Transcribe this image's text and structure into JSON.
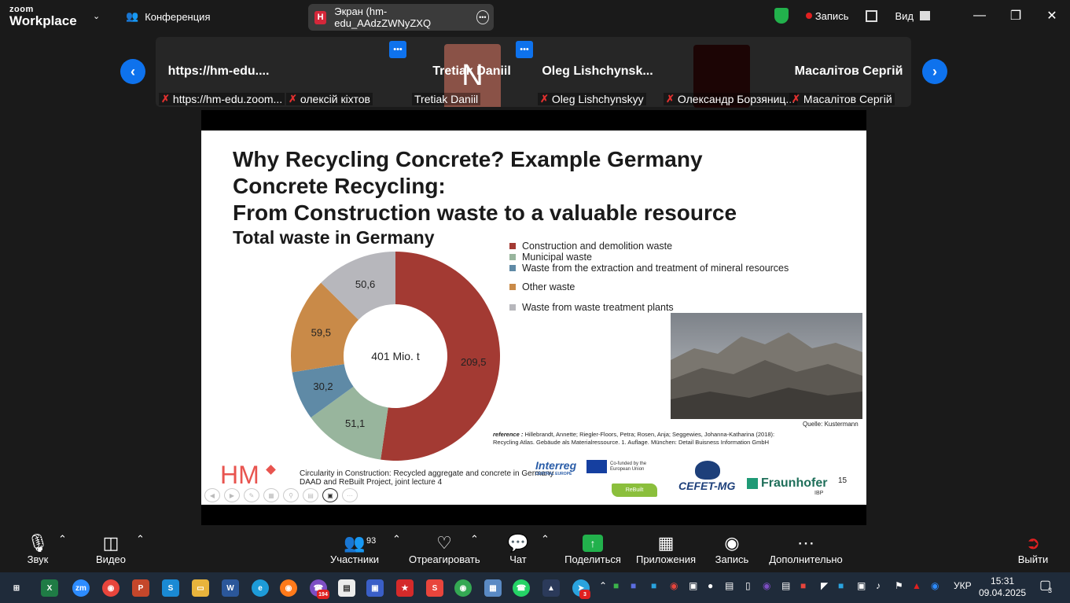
{
  "app": {
    "logo_top": "zoom",
    "logo_bottom": "Workplace"
  },
  "topbar": {
    "conference_label": "Конференция",
    "screen_tab_letter": "H",
    "screen_tab_label": "Экран (hm-edu_AAdzZWNyZXQ",
    "record_label": "Запись",
    "view_label": "Вид"
  },
  "participants_strip": [
    {
      "big": "https://hm-edu....",
      "caption": "https://hm-edu.zoom..."
    },
    {
      "avatar_letter": "N",
      "caption": "олексій кіхтов"
    },
    {
      "big": "Tretiak Daniil",
      "caption": "Tretiak Daniil"
    },
    {
      "big": "Oleg  Lishchynsk...",
      "caption": "Oleg Lishchynskyy"
    },
    {
      "caption": "Олександр Борзяниц..."
    },
    {
      "big": "Масалітов Сергій",
      "caption": "Масалітов Сергій"
    }
  ],
  "slide": {
    "title_lines": [
      "Why Recycling Concrete? Example Germany",
      "Concrete Recycling:",
      "From Construction waste to a valuable resource"
    ],
    "subtitle": "Total waste in Germany",
    "photo_source": "Quelle: Kustermann",
    "reference_label": "reference :",
    "reference_text": "Hillebrandt, Annette; Riegler-Floors, Petra; Rosen, Anja; Seggewies, Johanna-Katharina (2018): Recycling Atlas. Gebäude als Materialressource. 1. Auflage. München: Detail Buisness Information GmbH",
    "footer_line1": "Circularity in Construction: Recycled aggregate and concrete in Germany",
    "footer_line2": "DAAD and ReBuilt Project, joint lecture 4",
    "hm_logo": "HM",
    "interreg": "Interreg",
    "interreg_sub": "CENTRAL EUROPE",
    "eu_text": "Co-funded by the European Union",
    "rebuilt": "ReBuilt",
    "cefet": "CEFET-MG",
    "fraunhofer": "Fraunhofer",
    "ibp": "IBP",
    "page_number": "15"
  },
  "chart_data": {
    "type": "pie",
    "center_label": "401 Mio. t",
    "categories": [
      "Construction and demolition waste",
      "Municipal waste",
      "Waste from the extraction and treatment of mineral resources",
      "Other waste",
      "Waste from waste treatment plants"
    ],
    "values": [
      209.5,
      51.1,
      30.2,
      59.5,
      50.6
    ],
    "value_labels": [
      "209,5",
      "51,1",
      "30,2",
      "59,5",
      "50,6"
    ],
    "colors": [
      "#a33a33",
      "#98b59d",
      "#5f8aa6",
      "#c98a48",
      "#b7b7bc"
    ],
    "legend_position": "right"
  },
  "toolbar": {
    "audio": "Звук",
    "video": "Видео",
    "participants": "Участники",
    "participants_count": "93",
    "react": "Отреагировать",
    "chat": "Чат",
    "share": "Поделиться",
    "apps": "Приложения",
    "record": "Запись",
    "more": "Дополнительно",
    "leave": "Выйти"
  },
  "taskbar": {
    "viber_badge": "194",
    "telegram_badge": "3",
    "lang": "УКР",
    "time": "15:31",
    "date": "09.04.2025",
    "notif_count": "3"
  }
}
